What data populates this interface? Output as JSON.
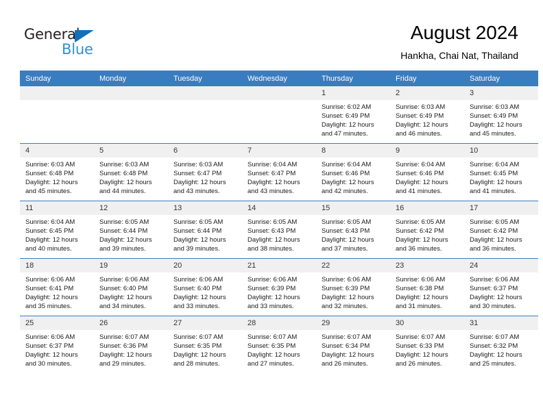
{
  "brand": {
    "name_top": "General",
    "name_bottom": "Blue",
    "color_dark": "#231f20",
    "color_blue": "#2e90d6",
    "triangle_color": "#1271bb"
  },
  "header": {
    "title": "August 2024",
    "subtitle": "Hankha, Chai Nat, Thailand"
  },
  "theme": {
    "header_bar": "#3a7cc0",
    "daynum_bg": "#f0f0f0",
    "text": "#1a1a1a"
  },
  "weekdays": [
    "Sunday",
    "Monday",
    "Tuesday",
    "Wednesday",
    "Thursday",
    "Friday",
    "Saturday"
  ],
  "weeks": [
    [
      {
        "day": "",
        "empty": true
      },
      {
        "day": "",
        "empty": true
      },
      {
        "day": "",
        "empty": true
      },
      {
        "day": "",
        "empty": true
      },
      {
        "day": "1",
        "sunrise": "Sunrise: 6:02 AM",
        "sunset": "Sunset: 6:49 PM",
        "daylight": "Daylight: 12 hours and 47 minutes."
      },
      {
        "day": "2",
        "sunrise": "Sunrise: 6:03 AM",
        "sunset": "Sunset: 6:49 PM",
        "daylight": "Daylight: 12 hours and 46 minutes."
      },
      {
        "day": "3",
        "sunrise": "Sunrise: 6:03 AM",
        "sunset": "Sunset: 6:49 PM",
        "daylight": "Daylight: 12 hours and 45 minutes."
      }
    ],
    [
      {
        "day": "4",
        "sunrise": "Sunrise: 6:03 AM",
        "sunset": "Sunset: 6:48 PM",
        "daylight": "Daylight: 12 hours and 45 minutes."
      },
      {
        "day": "5",
        "sunrise": "Sunrise: 6:03 AM",
        "sunset": "Sunset: 6:48 PM",
        "daylight": "Daylight: 12 hours and 44 minutes."
      },
      {
        "day": "6",
        "sunrise": "Sunrise: 6:03 AM",
        "sunset": "Sunset: 6:47 PM",
        "daylight": "Daylight: 12 hours and 43 minutes."
      },
      {
        "day": "7",
        "sunrise": "Sunrise: 6:04 AM",
        "sunset": "Sunset: 6:47 PM",
        "daylight": "Daylight: 12 hours and 43 minutes."
      },
      {
        "day": "8",
        "sunrise": "Sunrise: 6:04 AM",
        "sunset": "Sunset: 6:46 PM",
        "daylight": "Daylight: 12 hours and 42 minutes."
      },
      {
        "day": "9",
        "sunrise": "Sunrise: 6:04 AM",
        "sunset": "Sunset: 6:46 PM",
        "daylight": "Daylight: 12 hours and 41 minutes."
      },
      {
        "day": "10",
        "sunrise": "Sunrise: 6:04 AM",
        "sunset": "Sunset: 6:45 PM",
        "daylight": "Daylight: 12 hours and 41 minutes."
      }
    ],
    [
      {
        "day": "11",
        "sunrise": "Sunrise: 6:04 AM",
        "sunset": "Sunset: 6:45 PM",
        "daylight": "Daylight: 12 hours and 40 minutes."
      },
      {
        "day": "12",
        "sunrise": "Sunrise: 6:05 AM",
        "sunset": "Sunset: 6:44 PM",
        "daylight": "Daylight: 12 hours and 39 minutes."
      },
      {
        "day": "13",
        "sunrise": "Sunrise: 6:05 AM",
        "sunset": "Sunset: 6:44 PM",
        "daylight": "Daylight: 12 hours and 39 minutes."
      },
      {
        "day": "14",
        "sunrise": "Sunrise: 6:05 AM",
        "sunset": "Sunset: 6:43 PM",
        "daylight": "Daylight: 12 hours and 38 minutes."
      },
      {
        "day": "15",
        "sunrise": "Sunrise: 6:05 AM",
        "sunset": "Sunset: 6:43 PM",
        "daylight": "Daylight: 12 hours and 37 minutes."
      },
      {
        "day": "16",
        "sunrise": "Sunrise: 6:05 AM",
        "sunset": "Sunset: 6:42 PM",
        "daylight": "Daylight: 12 hours and 36 minutes."
      },
      {
        "day": "17",
        "sunrise": "Sunrise: 6:05 AM",
        "sunset": "Sunset: 6:42 PM",
        "daylight": "Daylight: 12 hours and 36 minutes."
      }
    ],
    [
      {
        "day": "18",
        "sunrise": "Sunrise: 6:06 AM",
        "sunset": "Sunset: 6:41 PM",
        "daylight": "Daylight: 12 hours and 35 minutes."
      },
      {
        "day": "19",
        "sunrise": "Sunrise: 6:06 AM",
        "sunset": "Sunset: 6:40 PM",
        "daylight": "Daylight: 12 hours and 34 minutes."
      },
      {
        "day": "20",
        "sunrise": "Sunrise: 6:06 AM",
        "sunset": "Sunset: 6:40 PM",
        "daylight": "Daylight: 12 hours and 33 minutes."
      },
      {
        "day": "21",
        "sunrise": "Sunrise: 6:06 AM",
        "sunset": "Sunset: 6:39 PM",
        "daylight": "Daylight: 12 hours and 33 minutes."
      },
      {
        "day": "22",
        "sunrise": "Sunrise: 6:06 AM",
        "sunset": "Sunset: 6:39 PM",
        "daylight": "Daylight: 12 hours and 32 minutes."
      },
      {
        "day": "23",
        "sunrise": "Sunrise: 6:06 AM",
        "sunset": "Sunset: 6:38 PM",
        "daylight": "Daylight: 12 hours and 31 minutes."
      },
      {
        "day": "24",
        "sunrise": "Sunrise: 6:06 AM",
        "sunset": "Sunset: 6:37 PM",
        "daylight": "Daylight: 12 hours and 30 minutes."
      }
    ],
    [
      {
        "day": "25",
        "sunrise": "Sunrise: 6:06 AM",
        "sunset": "Sunset: 6:37 PM",
        "daylight": "Daylight: 12 hours and 30 minutes."
      },
      {
        "day": "26",
        "sunrise": "Sunrise: 6:07 AM",
        "sunset": "Sunset: 6:36 PM",
        "daylight": "Daylight: 12 hours and 29 minutes."
      },
      {
        "day": "27",
        "sunrise": "Sunrise: 6:07 AM",
        "sunset": "Sunset: 6:35 PM",
        "daylight": "Daylight: 12 hours and 28 minutes."
      },
      {
        "day": "28",
        "sunrise": "Sunrise: 6:07 AM",
        "sunset": "Sunset: 6:35 PM",
        "daylight": "Daylight: 12 hours and 27 minutes."
      },
      {
        "day": "29",
        "sunrise": "Sunrise: 6:07 AM",
        "sunset": "Sunset: 6:34 PM",
        "daylight": "Daylight: 12 hours and 26 minutes."
      },
      {
        "day": "30",
        "sunrise": "Sunrise: 6:07 AM",
        "sunset": "Sunset: 6:33 PM",
        "daylight": "Daylight: 12 hours and 26 minutes."
      },
      {
        "day": "31",
        "sunrise": "Sunrise: 6:07 AM",
        "sunset": "Sunset: 6:32 PM",
        "daylight": "Daylight: 12 hours and 25 minutes."
      }
    ]
  ]
}
